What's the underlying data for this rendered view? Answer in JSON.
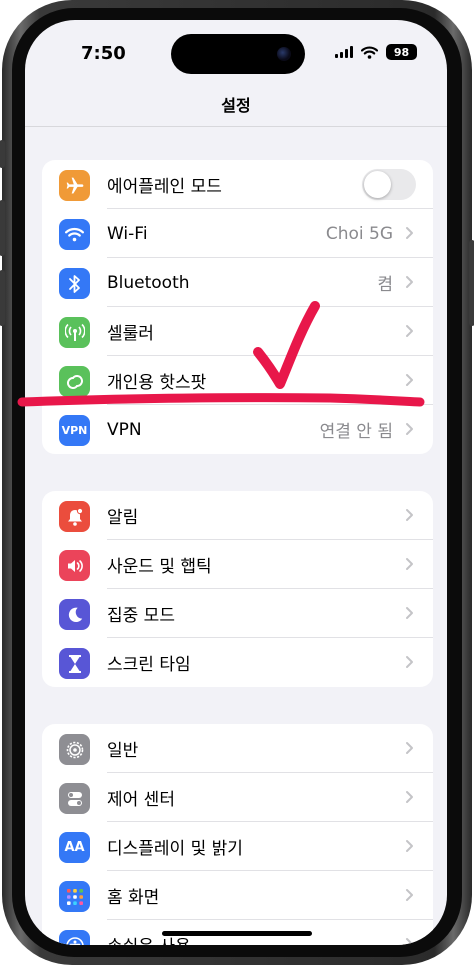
{
  "status_bar": {
    "time": "7:50",
    "battery": "98"
  },
  "nav": {
    "title": "설정"
  },
  "groups": [
    {
      "rows": [
        {
          "label": "에어플레인 모드",
          "icon": "airplane-icon",
          "color": "#f09a37",
          "toggle": false
        },
        {
          "label": "Wi-Fi",
          "value": "Choi 5G",
          "icon": "wifi-icon",
          "color": "#3478f6"
        },
        {
          "label": "Bluetooth",
          "value": "켬",
          "icon": "bluetooth-icon",
          "color": "#3478f6"
        },
        {
          "label": "셀룰러",
          "icon": "cellular-icon",
          "color": "#5ac15b"
        },
        {
          "label": "개인용 핫스팟",
          "icon": "hotspot-icon",
          "color": "#5ac15b"
        },
        {
          "label": "VPN",
          "value": "연결 안 됨",
          "icon": "vpn-icon",
          "icon_text": "VPN",
          "color": "#3478f6"
        }
      ]
    },
    {
      "rows": [
        {
          "label": "알림",
          "icon": "bell-icon",
          "color": "#eb4d3d"
        },
        {
          "label": "사운드 및 햅틱",
          "icon": "speaker-icon",
          "color": "#eb445a"
        },
        {
          "label": "집중 모드",
          "icon": "moon-icon",
          "color": "#5856d6"
        },
        {
          "label": "스크린 타임",
          "icon": "hourglass-icon",
          "color": "#5856d6"
        }
      ]
    },
    {
      "rows": [
        {
          "label": "일반",
          "icon": "gear-icon",
          "color": "#8e8e93"
        },
        {
          "label": "제어 센터",
          "icon": "switches-icon",
          "color": "#8e8e93"
        },
        {
          "label": "디스플레이 및 밝기",
          "icon": "text-size-icon",
          "icon_text": "AA",
          "color": "#3478f6"
        },
        {
          "label": "홈 화면",
          "icon": "home-grid-icon",
          "color": "#3478f6"
        },
        {
          "label": "손쉬운 사용",
          "icon": "accessibility-icon",
          "color": "#3478f6"
        }
      ]
    }
  ],
  "annotation": {
    "color": "#e8174a",
    "marks": [
      "checkmark",
      "underline"
    ]
  }
}
